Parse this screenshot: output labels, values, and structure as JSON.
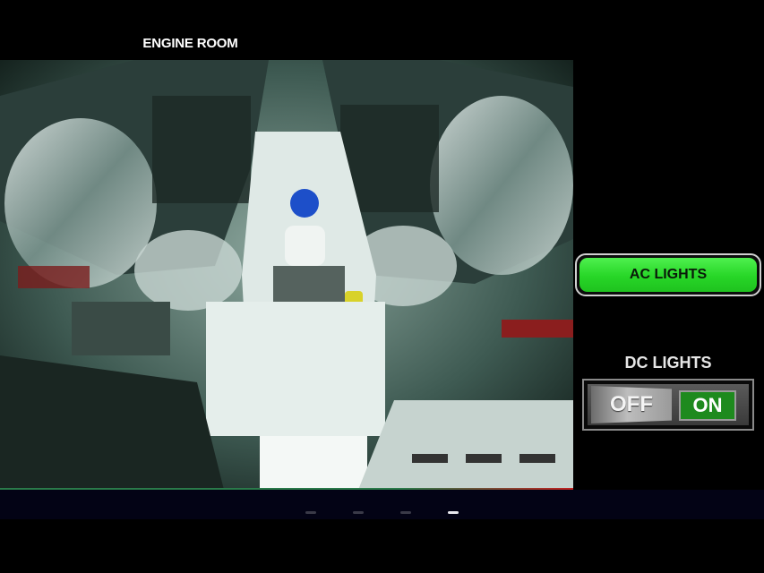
{
  "camera": {
    "title": "ENGINE ROOM"
  },
  "controls": {
    "ac_lights": {
      "label": "AC LIGHTS",
      "color": "#2ee02e"
    },
    "dc_lights": {
      "label": "DC LIGHTS",
      "switch": {
        "off_label": "OFF",
        "on_label": "ON",
        "state": "on"
      }
    }
  },
  "pager": {
    "count": 4,
    "active_index": 3
  },
  "colors": {
    "background": "#000000",
    "accent_green": "#2ee02e",
    "switch_on_green": "#1e8a1e"
  }
}
